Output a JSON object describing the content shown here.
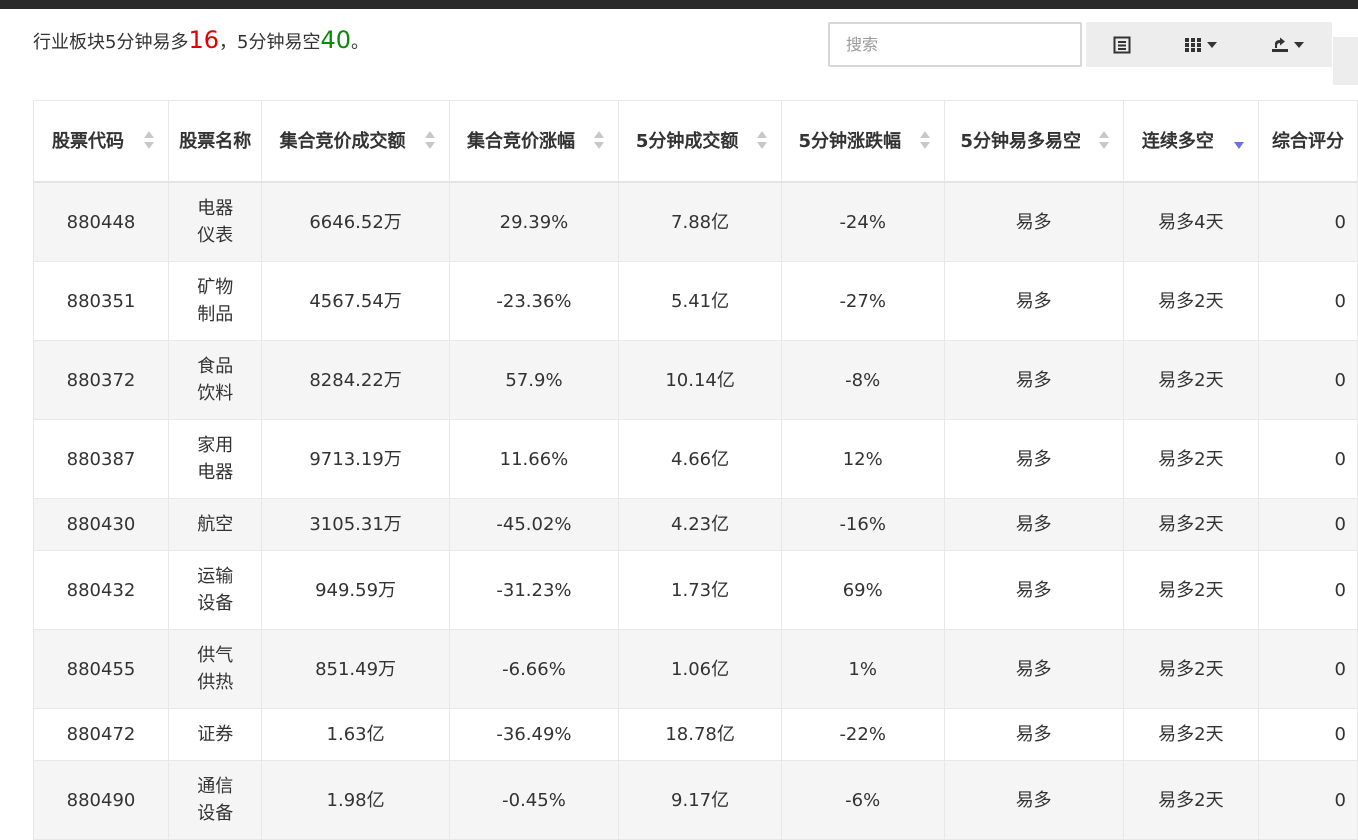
{
  "summary": {
    "prefix": "行业板块5分钟易多",
    "long_count": "16",
    "middle": "，5分钟易空",
    "short_count": "40",
    "suffix": "。"
  },
  "toolbar": {
    "search_placeholder": "搜索",
    "icons": [
      "list-view-icon",
      "columns-icon",
      "export-icon"
    ]
  },
  "table": {
    "columns": [
      {
        "key": "code",
        "label": "股票代码"
      },
      {
        "key": "name",
        "label": "股票名称"
      },
      {
        "key": "auction_amount",
        "label": "集合竞价成交额"
      },
      {
        "key": "auction_change",
        "label": "集合竞价涨幅"
      },
      {
        "key": "min5_amount",
        "label": "5分钟成交额"
      },
      {
        "key": "min5_change",
        "label": "5分钟涨跌幅"
      },
      {
        "key": "min5_signal",
        "label": "5分钟易多易空"
      },
      {
        "key": "streak",
        "label": "连续多空"
      },
      {
        "key": "score",
        "label": "综合评分"
      }
    ],
    "sorted_column": "streak",
    "sort_direction": "desc",
    "rows": [
      {
        "code": "880448",
        "name": "电器仪表",
        "auction_amount": "6646.52万",
        "auction_change": "29.39%",
        "min5_amount": "7.88亿",
        "min5_change": "-24%",
        "min5_signal": "易多",
        "streak": "易多4天",
        "score": "0"
      },
      {
        "code": "880351",
        "name": "矿物制品",
        "auction_amount": "4567.54万",
        "auction_change": "-23.36%",
        "min5_amount": "5.41亿",
        "min5_change": "-27%",
        "min5_signal": "易多",
        "streak": "易多2天",
        "score": "0"
      },
      {
        "code": "880372",
        "name": "食品饮料",
        "auction_amount": "8284.22万",
        "auction_change": "57.9%",
        "min5_amount": "10.14亿",
        "min5_change": "-8%",
        "min5_signal": "易多",
        "streak": "易多2天",
        "score": "0"
      },
      {
        "code": "880387",
        "name": "家用电器",
        "auction_amount": "9713.19万",
        "auction_change": "11.66%",
        "min5_amount": "4.66亿",
        "min5_change": "12%",
        "min5_signal": "易多",
        "streak": "易多2天",
        "score": "0"
      },
      {
        "code": "880430",
        "name": "航空",
        "auction_amount": "3105.31万",
        "auction_change": "-45.02%",
        "min5_amount": "4.23亿",
        "min5_change": "-16%",
        "min5_signal": "易多",
        "streak": "易多2天",
        "score": "0"
      },
      {
        "code": "880432",
        "name": "运输设备",
        "auction_amount": "949.59万",
        "auction_change": "-31.23%",
        "min5_amount": "1.73亿",
        "min5_change": "69%",
        "min5_signal": "易多",
        "streak": "易多2天",
        "score": "0"
      },
      {
        "code": "880455",
        "name": "供气供热",
        "auction_amount": "851.49万",
        "auction_change": "-6.66%",
        "min5_amount": "1.06亿",
        "min5_change": "1%",
        "min5_signal": "易多",
        "streak": "易多2天",
        "score": "0"
      },
      {
        "code": "880472",
        "name": "证券",
        "auction_amount": "1.63亿",
        "auction_change": "-36.49%",
        "min5_amount": "18.78亿",
        "min5_change": "-22%",
        "min5_signal": "易多",
        "streak": "易多2天",
        "score": "0"
      },
      {
        "code": "880490",
        "name": "通信设备",
        "auction_amount": "1.98亿",
        "auction_change": "-0.45%",
        "min5_amount": "9.17亿",
        "min5_change": "-6%",
        "min5_signal": "易多",
        "streak": "易多2天",
        "score": "0"
      }
    ]
  },
  "colors": {
    "long_count": "#e00000",
    "short_count": "#0a8a0a",
    "sort_active": "#6b74d9",
    "row_alt": "#f5f5f5"
  }
}
